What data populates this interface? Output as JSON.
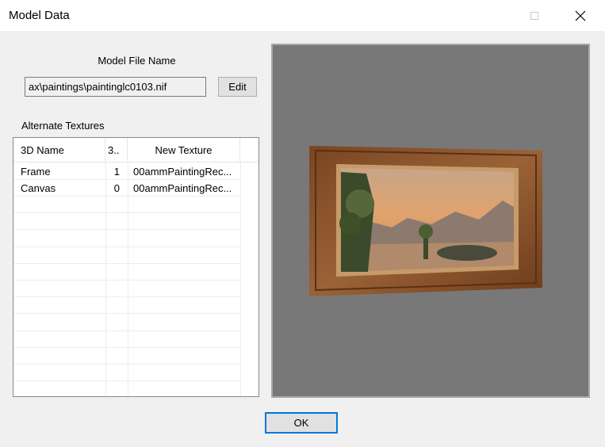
{
  "window": {
    "title": "Model Data",
    "minimize_icon": "minimize-icon",
    "maximize_icon": "maximize-icon",
    "close_icon": "close-icon"
  },
  "model": {
    "label": "Model File Name",
    "path_value": "ax\\paintings\\paintinglc0103.nif",
    "edit_label": "Edit"
  },
  "textures": {
    "label": "Alternate Textures",
    "columns": [
      "3D Name",
      "3..",
      "New Texture",
      ""
    ],
    "rows": [
      {
        "name": "Frame",
        "index": "1",
        "texture": "00ammPaintingRec..."
      },
      {
        "name": "Canvas",
        "index": "0",
        "texture": "00ammPaintingRec..."
      }
    ]
  },
  "preview": {
    "background": "#787878",
    "frame_color": "#8a5530",
    "sky_color": "#d9a070"
  },
  "footer": {
    "ok_label": "OK"
  }
}
